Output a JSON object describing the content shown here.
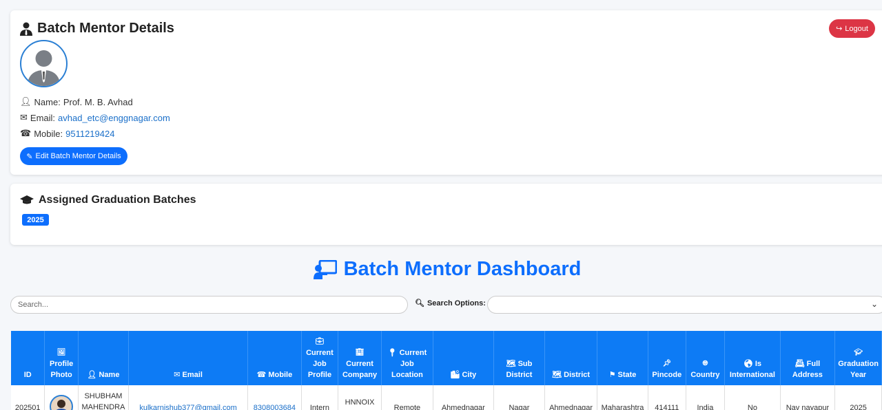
{
  "mentor_card": {
    "title": "Batch Mentor Details",
    "logout_label": "Logout",
    "name_label": "Name:",
    "name_value": "Prof. M. B. Avhad",
    "email_label": "Email:",
    "email_value": "avhad_etc@enggnagar.com",
    "mobile_label": "Mobile:",
    "mobile_value": "9511219424",
    "edit_label": "Edit Batch Mentor Details"
  },
  "batches_card": {
    "title": "Assigned Graduation Batches",
    "badges": [
      "2025"
    ]
  },
  "dashboard": {
    "title": "Batch Mentor Dashboard",
    "search_placeholder": "Search...",
    "search_options_label": "Search Options:",
    "search_options_value": ""
  },
  "table": {
    "headers": [
      "ID",
      "Profile Photo",
      "Name",
      "Email",
      "Mobile",
      "Current Job Profile",
      "Current Company",
      "Current Job Location",
      "City",
      "Sub District",
      "District",
      "State",
      "Pincode",
      "Country",
      "Is International",
      "Full Address",
      "Graduation Year"
    ],
    "rows": [
      {
        "id": "202501",
        "name": "SHUBHAM MAHENDRA",
        "email": "kulkarnishub377@gmail.com",
        "mobile": "8308003684",
        "job_profile": "Intern",
        "company": "HNNOIX",
        "job_location": "Remote",
        "city": "Ahmednagar",
        "sub_district": "Nagar",
        "district": "Ahmednagar",
        "state": "Maharashtra",
        "pincode": "414111",
        "country": "India",
        "is_international": "No",
        "address": "Nav nayapur",
        "grad_year": "2025"
      }
    ]
  },
  "colors": {
    "primary": "#0d6efd",
    "danger": "#dc3545",
    "table_header": "#0d7bf5"
  }
}
